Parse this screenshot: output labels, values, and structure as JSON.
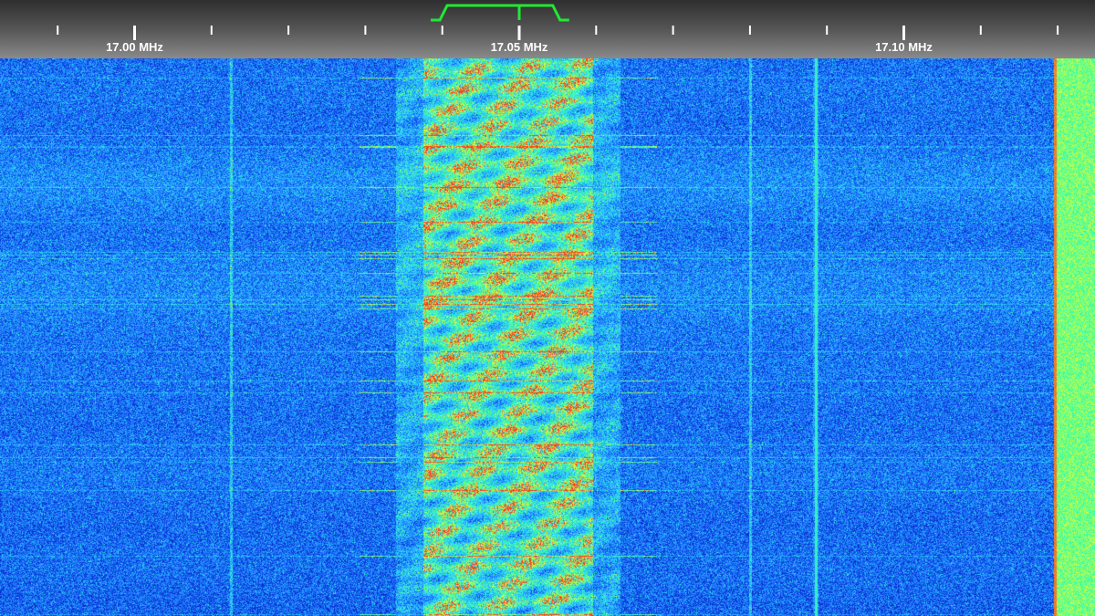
{
  "frequency_scale": {
    "labels": [
      {
        "text": "17.00 MHz",
        "mhz": 17.0
      },
      {
        "text": "17.05 MHz",
        "mhz": 17.05
      },
      {
        "text": "17.10 MHz",
        "mhz": 17.1
      }
    ],
    "major_ticks_mhz": [
      17.0,
      17.05,
      17.1
    ],
    "minor_ticks_mhz": [
      16.99,
      17.01,
      17.02,
      17.03,
      17.04,
      17.06,
      17.07,
      17.08,
      17.09,
      17.11,
      17.12
    ]
  },
  "tuning": {
    "filter_low_mhz": 17.0385,
    "filter_high_mhz": 17.0565,
    "center_mhz": 17.05,
    "marker_color": "#22e833"
  },
  "waterfall": {
    "signals": [
      {
        "kind": "wideband",
        "low_mhz": 17.0375,
        "high_mhz": 17.0595
      },
      {
        "kind": "carrier",
        "mhz": 17.0885
      },
      {
        "kind": "faint-carrier",
        "mhz": 17.0125
      },
      {
        "kind": "faint-carrier",
        "mhz": 17.08
      },
      {
        "kind": "edge-band",
        "low_mhz": 17.1195,
        "high_mhz": 17.1235
      }
    ],
    "palette": [
      "#06126a",
      "#0a2ad0",
      "#1d7cff",
      "#2fd6ff",
      "#3dff9a",
      "#e8ff3a",
      "#ff3a1a"
    ]
  }
}
